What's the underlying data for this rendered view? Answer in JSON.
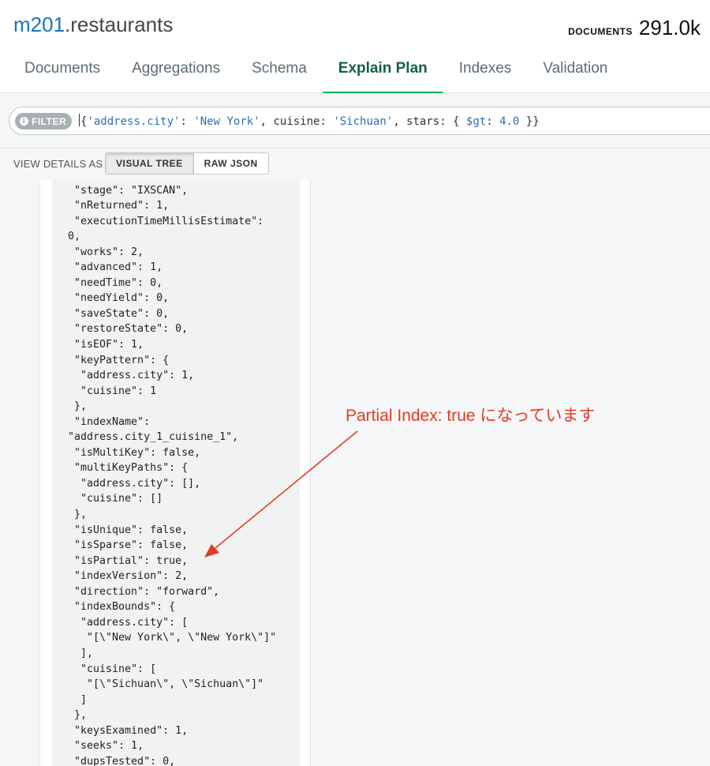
{
  "header": {
    "db_name": "m201",
    "collection_name": ".restaurants",
    "documents_label": "DOCUMENTS",
    "documents_count": "291.0k"
  },
  "tabs": [
    {
      "label": "Documents",
      "active": false
    },
    {
      "label": "Aggregations",
      "active": false
    },
    {
      "label": "Schema",
      "active": false
    },
    {
      "label": "Explain Plan",
      "active": true
    },
    {
      "label": "Indexes",
      "active": false
    },
    {
      "label": "Validation",
      "active": false
    }
  ],
  "filter": {
    "pill_label": "FILTER",
    "value_parts": {
      "open": "{",
      "k1": "'address.city'",
      "c1": ": ",
      "v1": "'New York'",
      "c2": ", cuisine: ",
      "v2": "'Sichuan'",
      "c3": ", stars: { ",
      "op": "$gt",
      "c4": ": ",
      "num": "4.0",
      "close": " }}"
    }
  },
  "view_details": {
    "label": "VIEW DETAILS AS",
    "options": [
      {
        "label": "VISUAL TREE",
        "active": true
      },
      {
        "label": "RAW JSON",
        "active": false
      }
    ]
  },
  "code_lines": [
    "{",
    " \"stage\": \"IXSCAN\",",
    " \"nReturned\": 1,",
    " \"executionTimeMillisEstimate\":",
    "0,",
    " \"works\": 2,",
    " \"advanced\": 1,",
    " \"needTime\": 0,",
    " \"needYield\": 0,",
    " \"saveState\": 0,",
    " \"restoreState\": 0,",
    " \"isEOF\": 1,",
    " \"keyPattern\": {",
    "  \"address.city\": 1,",
    "  \"cuisine\": 1",
    " },",
    " \"indexName\":",
    "\"address.city_1_cuisine_1\",",
    " \"isMultiKey\": false,",
    " \"multiKeyPaths\": {",
    "  \"address.city\": [],",
    "  \"cuisine\": []",
    " },",
    " \"isUnique\": false,",
    " \"isSparse\": false,",
    " \"isPartial\": true,",
    " \"indexVersion\": 2,",
    " \"direction\": \"forward\",",
    " \"indexBounds\": {",
    "  \"address.city\": [",
    "   \"[\\\"New York\\\", \\\"New York\\\"]\"",
    "  ],",
    "  \"cuisine\": [",
    "   \"[\\\"Sichuan\\\", \\\"Sichuan\\\"]\"",
    "  ]",
    " },",
    " \"keysExamined\": 1,",
    " \"seeks\": 1,",
    " \"dupsTested\": 0,"
  ],
  "annotation": {
    "text": "Partial Index: true になっています",
    "color": "#e53b23"
  }
}
